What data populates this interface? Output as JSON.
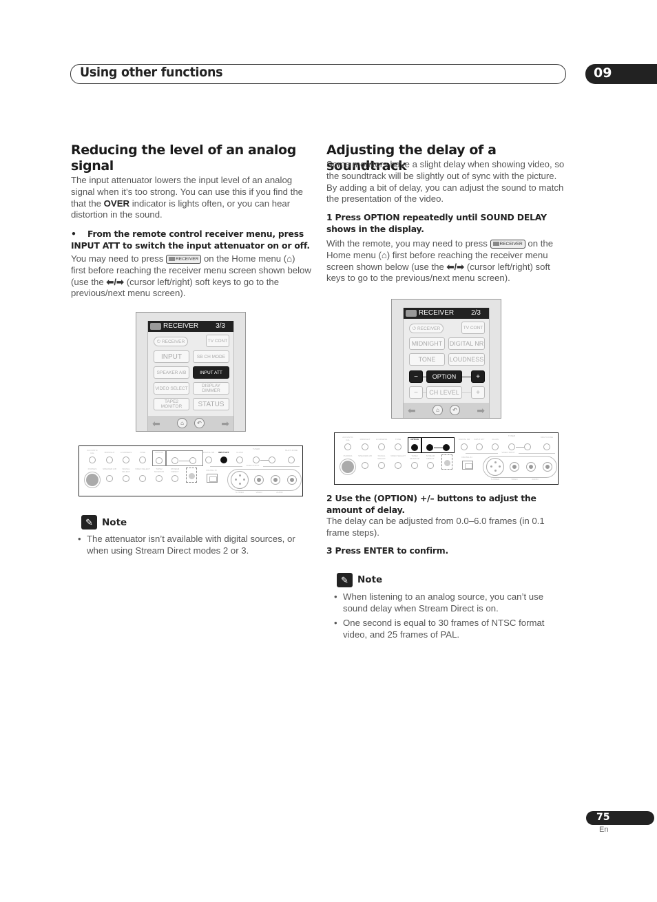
{
  "header": {
    "chapter_title": "Using other functions",
    "chapter_number": "09"
  },
  "left": {
    "heading": "Reducing the level of an analog signal",
    "intro_pre": "The input attenuator lowers the input level of an analog signal when it’s too strong. You can use this if you find the that the ",
    "intro_bold": "OVER",
    "intro_post": " indicator is lights often, or you can hear distortion in the sound.",
    "step_bullet": "•",
    "step": "From the remote control receiver menu, press INPUT ATT to switch the input attenuator on or off.",
    "hint_1": "You may need to press ",
    "hint_btn": "RECEIVER",
    "hint_2": " on the Home menu (",
    "hint_3": ") first before reaching the receiver menu screen shown below (use the ",
    "hint_arrows": "⬅/➡",
    "hint_4": " (cursor left/right) soft keys to go to the previous/next menu screen).",
    "remote": {
      "title": "RECEIVER",
      "page": "3/3",
      "buttons": {
        "receiver_power": "RECEIVER",
        "tv_cont": "TV CONT",
        "input": "INPUT",
        "sb_ch_mode": "SB CH MODE",
        "speaker_ab": "SPEAKER A/B",
        "input_att": "INPUT ATT",
        "video_select": "VIDEO SELECT",
        "display_dimmer": "DISPLAY DIMMER",
        "tape2_monitor": "TAPE2 MONITOR",
        "status": "STATUS"
      }
    },
    "note": {
      "label": "Note",
      "items": [
        "The attenuator isn’t available with digital sources, or when using Stream Direct modes 2 or 3."
      ]
    }
  },
  "right": {
    "heading": "Adjusting the delay of a soundtrack",
    "intro": "Some monitors have a slight delay when showing video, so the soundtrack will be slightly out of sync with the picture. By adding a bit of delay, you can adjust the sound to match the presentation of the video.",
    "step1": "1    Press OPTION repeatedly until SOUND DELAY shows in the display.",
    "hint_1": "With the remote, you may need to press ",
    "hint_btn": "RECEIVER",
    "hint_2": " on the Home menu (",
    "hint_3": ") first before reaching the receiver menu screen shown below (use the ",
    "hint_arrows": "⬅/➡",
    "hint_4": " (cursor left/right) soft keys to go to the previous/next menu screen).",
    "remote": {
      "title": "RECEIVER",
      "page": "2/3",
      "buttons": {
        "receiver_power": "RECEIVER",
        "tv_cont": "TV CONT",
        "midnight": "MIDNIGHT",
        "digital_nr": "DIGITAL NR",
        "tone": "TONE",
        "loudness": "LOUDNESS",
        "option_minus": "−",
        "option": "OPTION",
        "option_plus": "+",
        "ch_minus": "−",
        "ch_level": "CH LEVEL",
        "ch_plus": "+"
      }
    },
    "step2": "2    Use the (OPTION) +/– buttons to adjust the amount of delay.",
    "step2_detail": "The delay can be adjusted from 0.0–6.0 frames (in 0.1 frame steps).",
    "step3": "3    Press ENTER to confirm.",
    "note": {
      "label": "Note",
      "items": [
        "When listening to an analog source, you can’t use sound delay when Stream Direct is on.",
        "One second is equal to 30 frames of NTSC format video, and 25 frames of PAL."
      ]
    }
  },
  "front_panel": {
    "row1_labels": [
      "ACOUSTIC CAL",
      "MIDNIGHT",
      "LOUDNESS",
      "TONE",
      "OPTION",
      "−",
      "+",
      "DIGITAL NR",
      "INPUT ATT",
      "CLASS",
      "−",
      "STATION",
      "+",
      "MULTI ZONE"
    ],
    "tuner_label": "TUNER",
    "row2_labels": [
      "PHONES",
      "SPEAKER A/B",
      "SIGNAL SELECT",
      "VIDEO SELECT",
      "TAPE2 MONITOR",
      "STREAM DIRECT",
      "SETUP MIC",
      "DIGITAL IN"
    ],
    "video_input_label": "VIDEO INPUT",
    "jack_labels": [
      "S-VIDEO",
      "VIDEO",
      "L",
      "AUDIO",
      "R"
    ]
  },
  "footer": {
    "page_number": "75",
    "language": "En"
  }
}
